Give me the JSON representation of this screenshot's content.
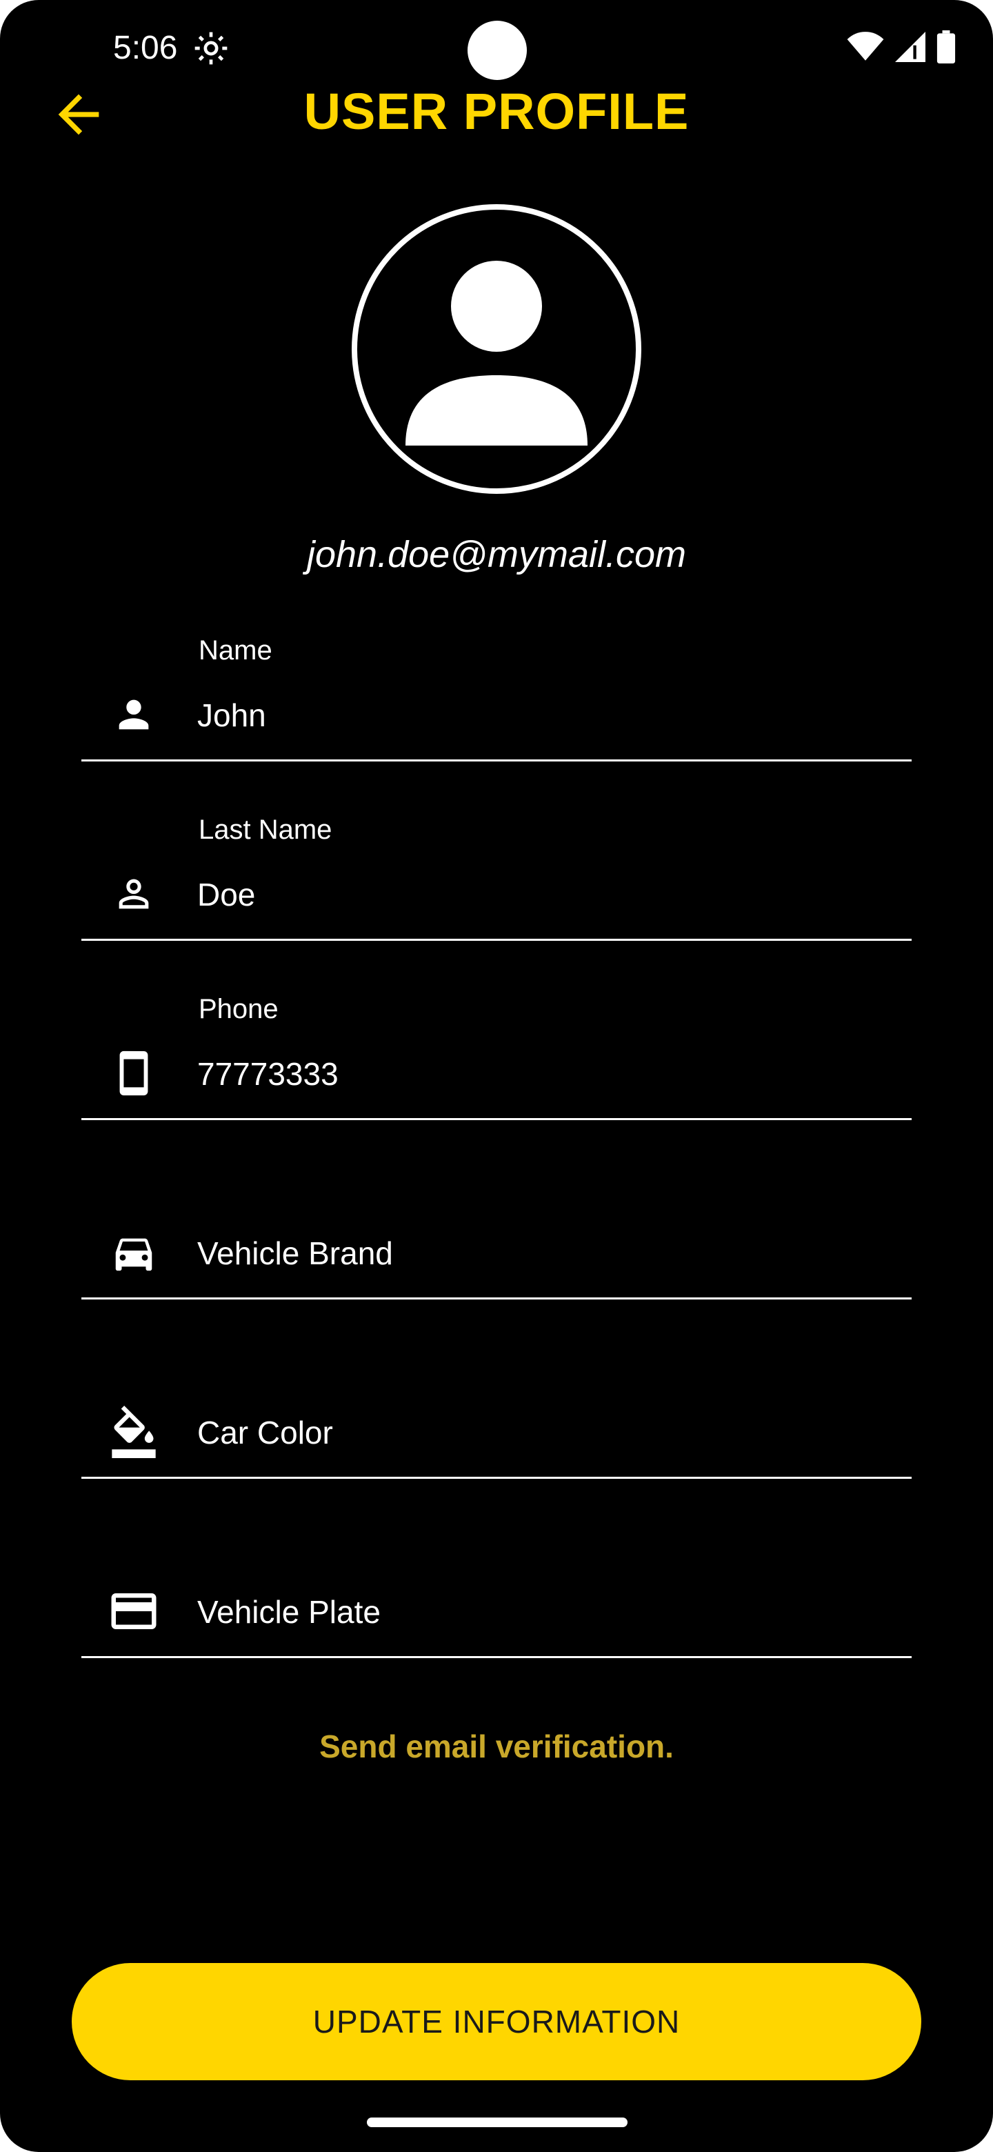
{
  "status_bar": {
    "time": "5:06",
    "icons": [
      "settings-gear-icon",
      "wifi-icon",
      "signal-icon",
      "battery-icon"
    ]
  },
  "header": {
    "title": "USER PROFILE",
    "back_icon": "arrow-left-icon"
  },
  "profile": {
    "avatar_icon": "person-silhouette-icon",
    "email": "john.doe@mymail.com"
  },
  "fields": [
    {
      "label": "Name",
      "value": "John",
      "placeholder": "",
      "icon": "person-filled-icon"
    },
    {
      "label": "Last Name",
      "value": "Doe",
      "placeholder": "",
      "icon": "person-outline-icon"
    },
    {
      "label": "Phone",
      "value": "77773333",
      "placeholder": "",
      "icon": "smartphone-icon"
    },
    {
      "label": "",
      "value": "",
      "placeholder": "Vehicle Brand",
      "icon": "car-icon"
    },
    {
      "label": "",
      "value": "",
      "placeholder": "Car Color",
      "icon": "paint-bucket-icon"
    },
    {
      "label": "",
      "value": "",
      "placeholder": "Vehicle Plate",
      "icon": "credit-card-icon"
    }
  ],
  "actions": {
    "verify_text": "Send email verification.",
    "update_label": "UPDATE INFORMATION"
  },
  "colors": {
    "background": "#000000",
    "accent": "#ffd600",
    "link": "#c9a82a",
    "text": "#ffffff"
  }
}
